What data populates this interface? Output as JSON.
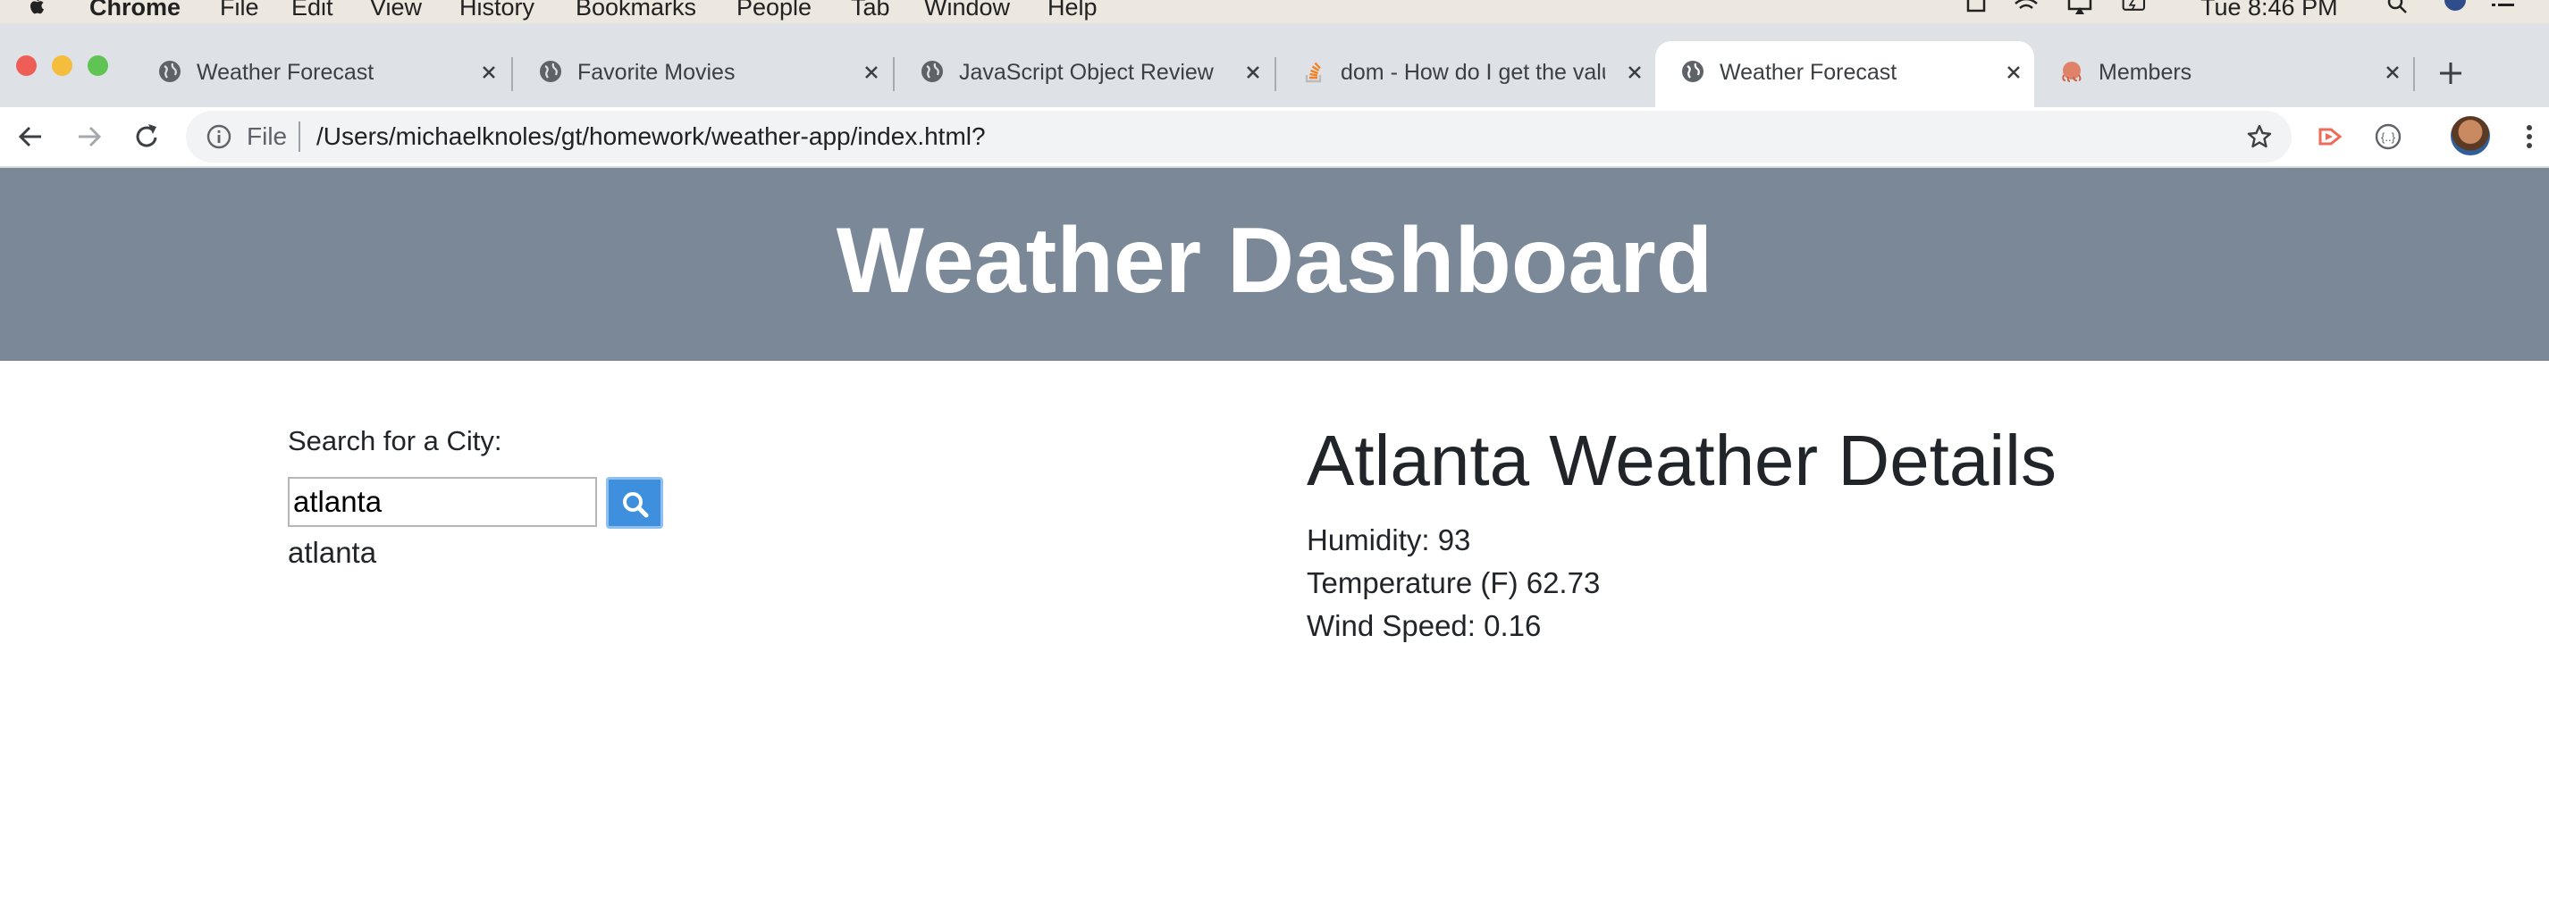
{
  "menubar": {
    "app_name": "Chrome",
    "menus": [
      "File",
      "Edit",
      "View",
      "History",
      "Bookmarks",
      "People",
      "Tab",
      "Window",
      "Help"
    ],
    "clock": "Tue 8:46 PM"
  },
  "tabs": [
    {
      "title": "Weather Forecast",
      "favicon": "globe-icon",
      "active": false
    },
    {
      "title": "Favorite Movies",
      "favicon": "globe-icon",
      "active": false
    },
    {
      "title": "JavaScript Object Review",
      "favicon": "globe-icon",
      "active": false
    },
    {
      "title": "dom - How do I get the valu",
      "favicon": "stackoverflow-icon",
      "active": false
    },
    {
      "title": "Weather Forecast",
      "favicon": "globe-icon",
      "active": true
    },
    {
      "title": "Members",
      "favicon": "octocat-icon",
      "active": false
    }
  ],
  "address_bar": {
    "scheme_label": "File",
    "url": "/Users/michaelknoles/gt/homework/weather-app/index.html?"
  },
  "page": {
    "title": "Weather Dashboard",
    "search": {
      "label": "Search for a City:",
      "value": "atlanta",
      "placeholder": "",
      "history": [
        "atlanta"
      ]
    },
    "details": {
      "heading": "Atlanta Weather Details",
      "humidity": "Humidity: 93",
      "temperature": "Temperature (F) 62.73",
      "wind": "Wind Speed: 0.16"
    }
  },
  "colors": {
    "header_bg": "#7b8898",
    "button_bg": "#3f8fdf",
    "tabstrip_bg": "#dee1e6",
    "menubar_bg": "#ece7df"
  }
}
